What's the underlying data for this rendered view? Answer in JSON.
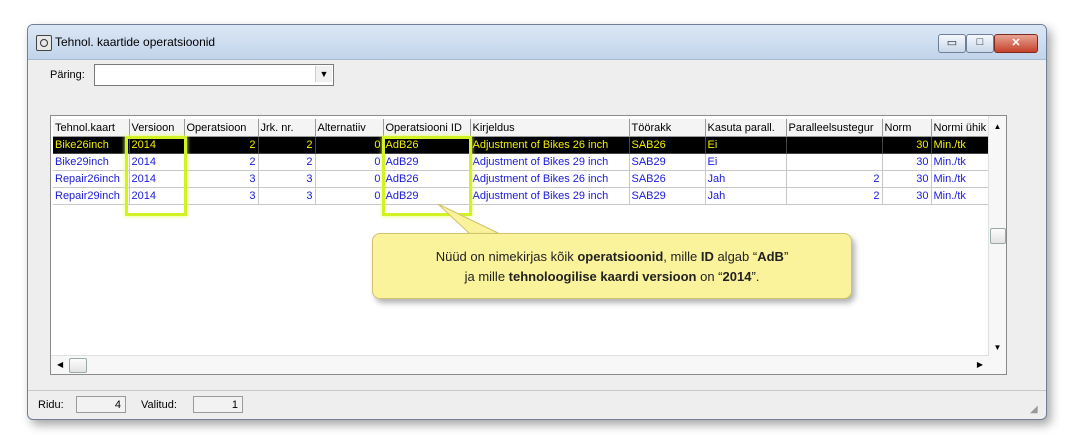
{
  "window": {
    "title": "Tehnol. kaartide operatsioonid",
    "buttons": {
      "minimize": "▭",
      "maximize": "□",
      "close": "✕"
    }
  },
  "query": {
    "label": "Päring:",
    "value": ""
  },
  "grid": {
    "columns": [
      "Tehnol.kaart",
      "Versioon",
      "Operatsioon",
      "Jrk. nr.",
      "Alternatiiv",
      "Operatsiooni ID",
      "Kirjeldus",
      "Töörakk",
      "Kasuta parall.",
      "Paralleelsustegur",
      "Norm",
      "Normi ühik"
    ],
    "rows": [
      [
        "Bike26inch",
        "2014",
        "2",
        "2",
        "0",
        "AdB26",
        "Adjustment of Bikes 26 inch",
        "SAB26",
        "Ei",
        "",
        "30",
        "Min./tk"
      ],
      [
        "Bike29inch",
        "2014",
        "2",
        "2",
        "0",
        "AdB29",
        "Adjustment of Bikes 29 inch",
        "SAB29",
        "Ei",
        "",
        "30",
        "Min./tk"
      ],
      [
        "Repair26inch",
        "2014",
        "3",
        "3",
        "0",
        "AdB26",
        "Adjustment of Bikes 26 inch",
        "SAB26",
        "Jah",
        "2",
        "30",
        "Min./tk"
      ],
      [
        "Repair29inch",
        "2014",
        "3",
        "3",
        "0",
        "AdB29",
        "Adjustment of Bikes 29 inch",
        "SAB29",
        "Jah",
        "2",
        "30",
        "Min./tk"
      ]
    ],
    "selected_row": 0
  },
  "status": {
    "rows_label": "Ridu:",
    "rows_value": "4",
    "selected_label": "Valitud:",
    "selected_value": "1"
  },
  "callout": {
    "line1_a": "Nüüd on nimekirjas kõik ",
    "line1_b": "operatsioonid",
    "line1_c": ", mille ",
    "line1_d": "ID",
    "line1_e": " algab “",
    "line1_f": "AdB",
    "line1_g": "”",
    "line2_a": "ja mille ",
    "line2_b": "tehnoloogilise kaardi versioon",
    "line2_c": " on “",
    "line2_d": "2014",
    "line2_e": "”."
  },
  "colors": {
    "highlight": "#d3f226",
    "row_text": "#1a1adb",
    "selected_text": "#f2ee00",
    "callout_bg": "#fbf39b"
  }
}
